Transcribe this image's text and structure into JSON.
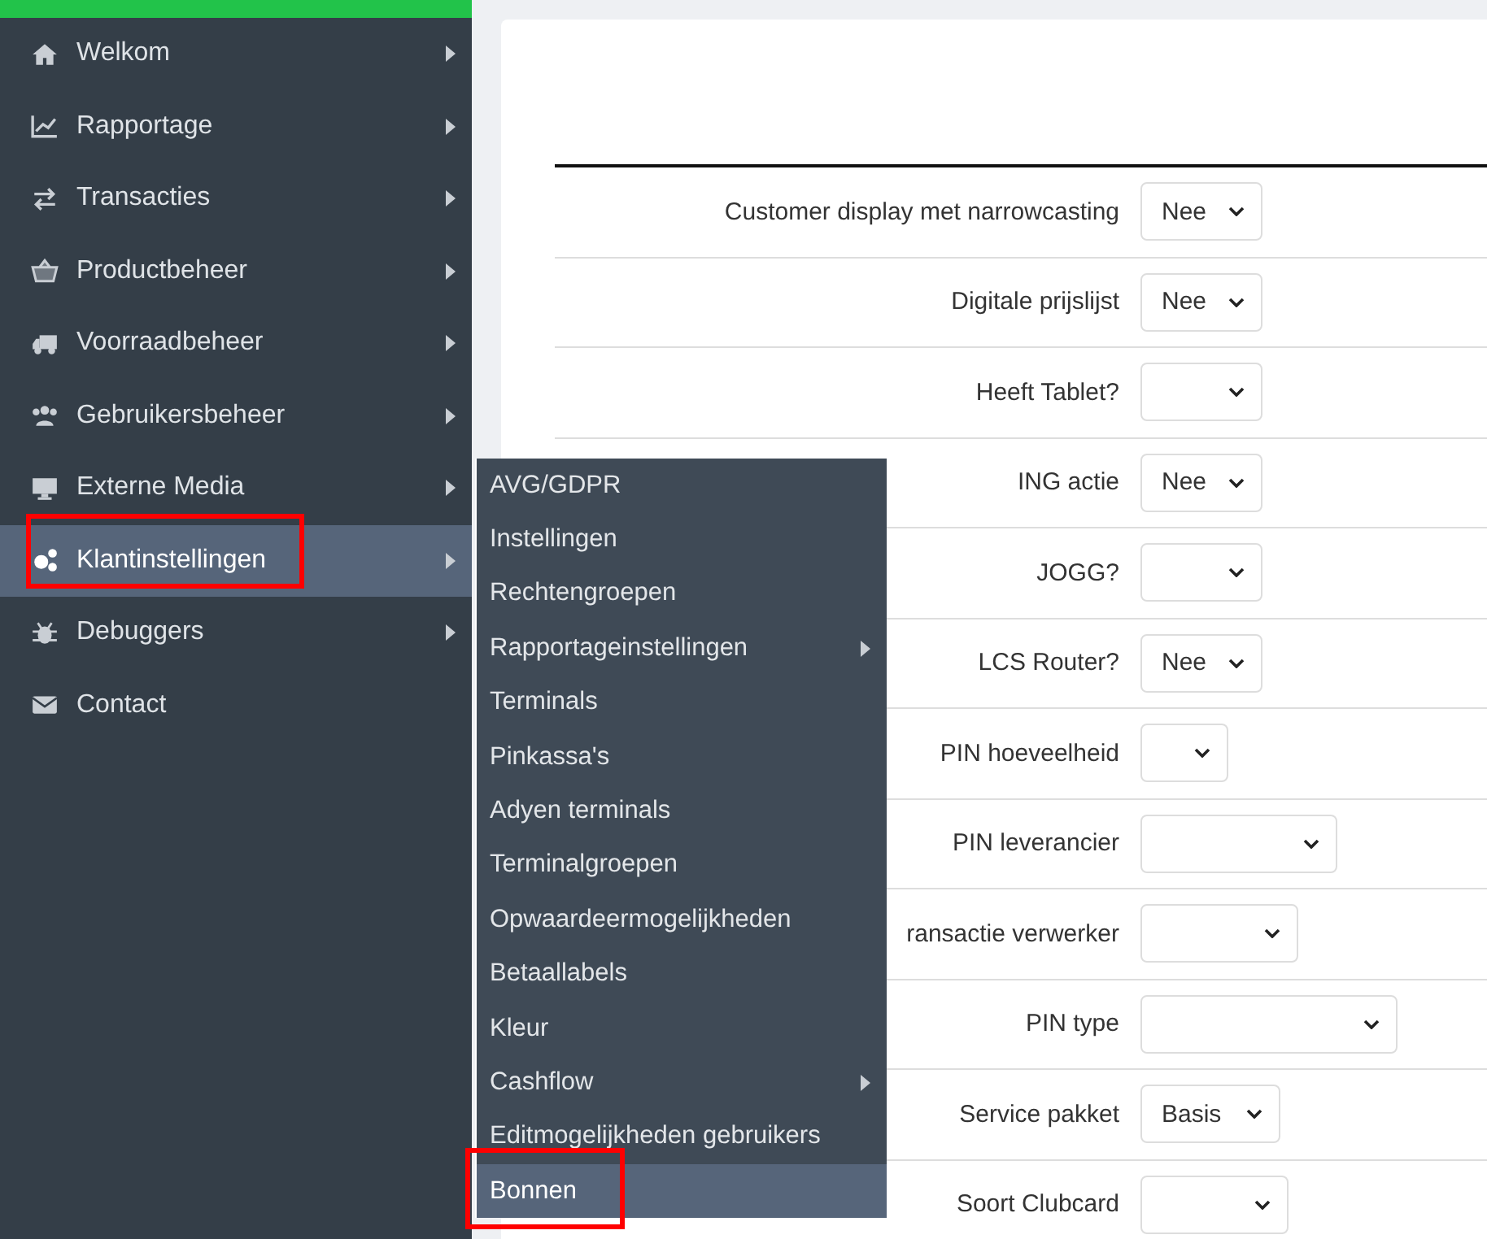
{
  "sidebar": {
    "items": [
      {
        "label": "Welkom",
        "selected": false,
        "highlighted": false,
        "has_submenu": true
      },
      {
        "label": "Rapportage",
        "selected": false,
        "highlighted": false,
        "has_submenu": true
      },
      {
        "label": "Transacties",
        "selected": false,
        "highlighted": false,
        "has_submenu": true
      },
      {
        "label": "Productbeheer",
        "selected": false,
        "highlighted": false,
        "has_submenu": true
      },
      {
        "label": "Voorraadbeheer",
        "selected": false,
        "highlighted": false,
        "has_submenu": true
      },
      {
        "label": "Gebruikersbeheer",
        "selected": false,
        "highlighted": false,
        "has_submenu": true
      },
      {
        "label": "Externe Media",
        "selected": false,
        "highlighted": false,
        "has_submenu": true
      },
      {
        "label": "Klantinstellingen",
        "selected": true,
        "highlighted": true,
        "has_submenu": true
      },
      {
        "label": "Debuggers",
        "selected": false,
        "highlighted": false,
        "has_submenu": true
      },
      {
        "label": "Contact",
        "selected": false,
        "highlighted": false,
        "has_submenu": false
      }
    ]
  },
  "submenu": {
    "items": [
      {
        "label": "AVG/GDPR",
        "selected": false,
        "highlighted": false,
        "has_submenu": false
      },
      {
        "label": "Instellingen",
        "selected": false,
        "highlighted": false,
        "has_submenu": false
      },
      {
        "label": "Rechtengroepen",
        "selected": false,
        "highlighted": false,
        "has_submenu": false
      },
      {
        "label": "Rapportageinstellingen",
        "selected": false,
        "highlighted": false,
        "has_submenu": true
      },
      {
        "label": "Terminals",
        "selected": false,
        "highlighted": false,
        "has_submenu": false
      },
      {
        "label": "Pinkassa's",
        "selected": false,
        "highlighted": false,
        "has_submenu": false
      },
      {
        "label": "Adyen terminals",
        "selected": false,
        "highlighted": false,
        "has_submenu": false
      },
      {
        "label": "Terminalgroepen",
        "selected": false,
        "highlighted": false,
        "has_submenu": false
      },
      {
        "label": "Opwaardeermogelijkheden",
        "selected": false,
        "highlighted": false,
        "has_submenu": false
      },
      {
        "label": "Betaallabels",
        "selected": false,
        "highlighted": false,
        "has_submenu": false
      },
      {
        "label": "Kleur",
        "selected": false,
        "highlighted": false,
        "has_submenu": false
      },
      {
        "label": "Cashflow",
        "selected": false,
        "highlighted": false,
        "has_submenu": true
      },
      {
        "label": "Editmogelijkheden gebruikers",
        "selected": false,
        "highlighted": false,
        "has_submenu": false
      },
      {
        "label": "Bonnen",
        "selected": true,
        "highlighted": true,
        "has_submenu": false
      }
    ]
  },
  "settings": {
    "rows": [
      {
        "label": "Customer display met narrowcasting",
        "value": "Nee"
      },
      {
        "label": "Digitale prijslijst",
        "value": "Nee"
      },
      {
        "label": "Heeft Tablet?",
        "value": ""
      },
      {
        "label": "ING actie",
        "value": "Nee"
      },
      {
        "label": "JOGG?",
        "value": ""
      },
      {
        "label": "LCS Router?",
        "value": "Nee"
      },
      {
        "label": "PIN hoeveelheid",
        "value": ""
      },
      {
        "label": "PIN leverancier",
        "value": ""
      },
      {
        "label": "ransactie verwerker",
        "value": ""
      },
      {
        "label": "PIN type",
        "value": ""
      },
      {
        "label": "Service pakket",
        "value": "Basis"
      },
      {
        "label": "Soort Clubcard",
        "value": ""
      }
    ]
  }
}
